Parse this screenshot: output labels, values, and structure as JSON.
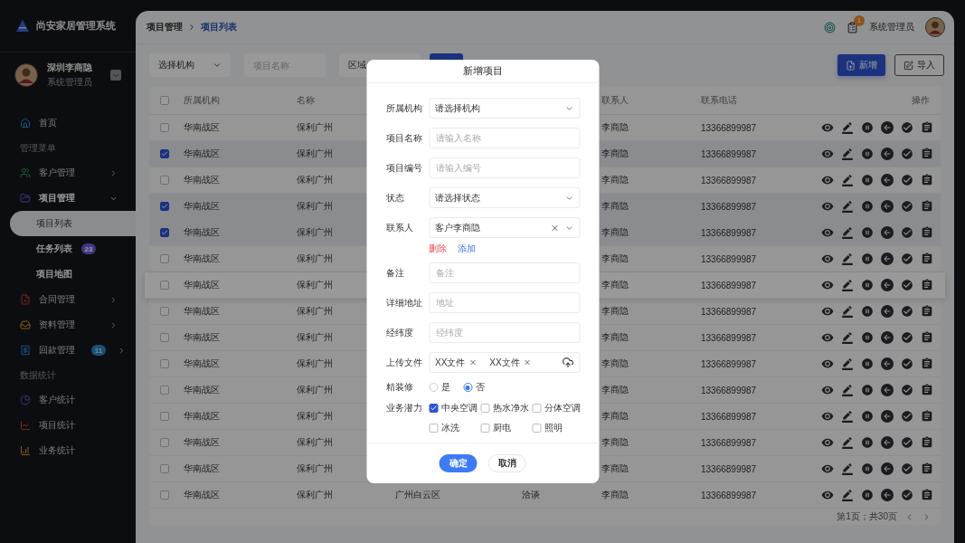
{
  "sidebar": {
    "brand": "尚安家居管理系统",
    "user": {
      "name": "深圳李商隐",
      "role": "系统管理员"
    },
    "nav": [
      {
        "kind": "item",
        "label": "首页",
        "selected": false
      },
      {
        "kind": "section",
        "label": "管理菜单"
      },
      {
        "kind": "item",
        "label": "客户管理",
        "selected": false,
        "expanded": false
      },
      {
        "kind": "item",
        "label": "项目管理",
        "selected": false,
        "expanded": true,
        "children": [
          {
            "label": "项目列表",
            "selected": true
          },
          {
            "label": "任务列表",
            "selected": false,
            "badge": "23"
          },
          {
            "label": "项目地图",
            "selected": false
          }
        ]
      },
      {
        "kind": "item",
        "label": "合同管理",
        "selected": false,
        "expanded": false
      },
      {
        "kind": "item",
        "label": "资料管理",
        "selected": false,
        "expanded": false
      },
      {
        "kind": "item",
        "label": "回款管理",
        "selected": false,
        "expanded": false,
        "badge": "11"
      },
      {
        "kind": "section",
        "label": "数据统计"
      },
      {
        "kind": "item",
        "label": "客户统计",
        "selected": false
      },
      {
        "kind": "item",
        "label": "项目统计",
        "selected": false
      },
      {
        "kind": "item",
        "label": "业务统计",
        "selected": false
      }
    ]
  },
  "header": {
    "breadcrumb": [
      "项目管理",
      "项目列表"
    ],
    "notification_count": "1",
    "user_name": "系统管理员"
  },
  "filters": [
    {
      "kind": "select",
      "value": "选择机构"
    },
    {
      "kind": "input",
      "placeholder": "项目名称"
    },
    {
      "kind": "field",
      "value": "区域"
    }
  ],
  "actions": [
    {
      "kind": "primary",
      "label": "新增"
    },
    {
      "kind": "outline",
      "label": "导入"
    }
  ],
  "table": {
    "all_selected": false,
    "columns": [
      "所属机构",
      "名称",
      "联系人",
      "联系电话",
      "操作"
    ],
    "rows": [
      {
        "selected": false,
        "hovered": false,
        "cells": [
          "华南战区",
          "保利广州",
          "李商隐",
          "13366899987"
        ]
      },
      {
        "selected": true,
        "hovered": false,
        "cells": [
          "华南战区",
          "保利广州",
          "李商隐",
          "13366899987"
        ]
      },
      {
        "selected": false,
        "hovered": false,
        "cells": [
          "华南战区",
          "保利广州",
          "李商隐",
          "13366899987"
        ]
      },
      {
        "selected": true,
        "hovered": false,
        "cells": [
          "华南战区",
          "保利广州",
          "李商隐",
          "13366899987"
        ]
      },
      {
        "selected": true,
        "hovered": false,
        "cells": [
          "华南战区",
          "保利广州",
          "李商隐",
          "13366899987"
        ]
      },
      {
        "selected": false,
        "hovered": false,
        "cells": [
          "华南战区",
          "保利广州",
          "李商隐",
          "13366899987"
        ]
      },
      {
        "selected": false,
        "hovered": true,
        "cells": [
          "华南战区",
          "保利广州",
          "李商隐",
          "13366899987"
        ]
      },
      {
        "selected": false,
        "hovered": false,
        "cells": [
          "华南战区",
          "保利广州",
          "李商隐",
          "13366899987"
        ]
      },
      {
        "selected": false,
        "hovered": false,
        "cells": [
          "华南战区",
          "保利广州",
          "李商隐",
          "13366899987"
        ]
      },
      {
        "selected": false,
        "hovered": false,
        "cells": [
          "华南战区",
          "保利广州",
          "李商隐",
          "13366899987"
        ]
      },
      {
        "selected": false,
        "hovered": false,
        "cells": [
          "华南战区",
          "保利广州",
          "李商隐",
          "13366899987"
        ]
      },
      {
        "selected": false,
        "hovered": false,
        "cells": [
          "华南战区",
          "保利广州",
          "李商隐",
          "13366899987"
        ]
      },
      {
        "selected": false,
        "hovered": false,
        "cells": [
          "华南战区",
          "保利广州",
          "李商隐",
          "13366899987"
        ]
      },
      {
        "selected": false,
        "hovered": false,
        "cells": [
          "华南战区",
          "保利广州",
          "李商隐",
          "13366899987"
        ]
      },
      {
        "selected": false,
        "hovered": false,
        "cells": [
          "华南战区",
          "保利广州",
          "李商隐",
          "13366899987"
        ],
        "column_3": "广州白云区",
        "column_4": "洽谈"
      }
    ]
  },
  "pagination": "第1页；共30页",
  "modal": {
    "title": "新增项目",
    "fields": [
      {
        "kind": "select",
        "label": "所属机构",
        "value": "请选择机构"
      },
      {
        "kind": "input",
        "label": "项目名称",
        "placeholder": "请输入名称"
      },
      {
        "kind": "input",
        "label": "项目编号",
        "placeholder": "请输入编号"
      },
      {
        "kind": "select",
        "label": "状态",
        "value": "请选择状态"
      },
      {
        "kind": "contact",
        "label": "联系人",
        "value": "客户李商隐",
        "links": [
          {
            "kind": "danger",
            "label": "删除"
          },
          {
            "kind": "link",
            "label": "添加"
          }
        ]
      },
      {
        "kind": "input",
        "label": "备注",
        "placeholder": "备注"
      },
      {
        "kind": "input",
        "label": "详细地址",
        "placeholder": "地址"
      },
      {
        "kind": "input",
        "label": "经纬度",
        "placeholder": "经纬度"
      },
      {
        "kind": "upload",
        "label": "上传文件",
        "files": [
          "XX文件",
          "XX文件"
        ]
      },
      {
        "kind": "radio",
        "label": "精装修",
        "options": [
          {
            "label": "是",
            "selected": false
          },
          {
            "label": "否",
            "selected": true
          }
        ]
      },
      {
        "kind": "checkbox",
        "label": "业务潜力",
        "options": [
          {
            "label": "中央空调",
            "checked": true
          },
          {
            "label": "热水净水",
            "checked": false
          },
          {
            "label": "分体空调",
            "checked": false
          },
          {
            "label": "冰洗",
            "checked": false
          },
          {
            "label": "厨电",
            "checked": false
          },
          {
            "label": "照明",
            "checked": false
          }
        ]
      }
    ],
    "buttons": [
      {
        "kind": "primary",
        "label": "确定"
      },
      {
        "kind": "default",
        "label": "取消"
      }
    ]
  }
}
